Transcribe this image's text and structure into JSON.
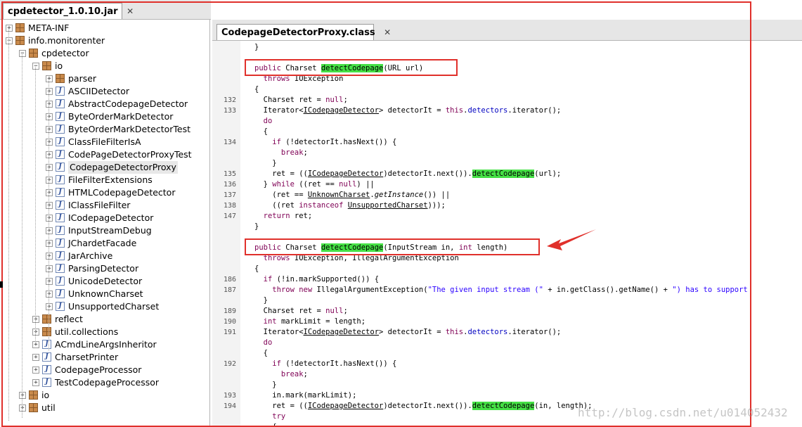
{
  "left_tab": {
    "label": "cpdetector_1.0.10.jar",
    "close": "✕"
  },
  "right_tab": {
    "label": "CodepageDetectorProxy.class",
    "close": "✕"
  },
  "tree": [
    {
      "label": "META-INF",
      "icon": "package-icon",
      "toggle": "+"
    },
    {
      "label": "info.monitorenter",
      "icon": "package-icon",
      "toggle": "−"
    },
    {
      "label": "cpdetector",
      "icon": "package-icon",
      "toggle": "−"
    },
    {
      "label": "io",
      "icon": "package-icon",
      "toggle": "−"
    },
    {
      "label": "parser",
      "icon": "package-icon",
      "toggle": "+"
    },
    {
      "label": "ASCIIDetector",
      "icon": "class-icon",
      "toggle": "+"
    },
    {
      "label": "AbstractCodepageDetector",
      "icon": "class-icon",
      "toggle": "+"
    },
    {
      "label": "ByteOrderMarkDetector",
      "icon": "class-icon",
      "toggle": "+"
    },
    {
      "label": "ByteOrderMarkDetectorTest",
      "icon": "class-icon",
      "toggle": "+"
    },
    {
      "label": "ClassFileFilterIsA",
      "icon": "class-icon",
      "toggle": "+"
    },
    {
      "label": "CodePageDetectorProxyTest",
      "icon": "class-icon",
      "toggle": "+"
    },
    {
      "label": "CodepageDetectorProxy",
      "icon": "class-icon",
      "toggle": "+",
      "selected": true
    },
    {
      "label": "FileFilterExtensions",
      "icon": "class-icon",
      "toggle": "+"
    },
    {
      "label": "HTMLCodepageDetector",
      "icon": "class-icon",
      "toggle": "+"
    },
    {
      "label": "IClassFileFilter",
      "icon": "class-icon",
      "toggle": "+"
    },
    {
      "label": "ICodepageDetector",
      "icon": "class-icon",
      "toggle": "+"
    },
    {
      "label": "InputStreamDebug",
      "icon": "class-icon",
      "toggle": "+"
    },
    {
      "label": "JChardetFacade",
      "icon": "class-icon",
      "toggle": "+"
    },
    {
      "label": "JarArchive",
      "icon": "class-icon",
      "toggle": "+"
    },
    {
      "label": "ParsingDetector",
      "icon": "class-icon",
      "toggle": "+"
    },
    {
      "label": "UnicodeDetector",
      "icon": "class-icon",
      "toggle": "+"
    },
    {
      "label": "UnknownCharset",
      "icon": "class-icon",
      "toggle": "+"
    },
    {
      "label": "UnsupportedCharset",
      "icon": "class-icon",
      "toggle": "+"
    },
    {
      "label": "reflect",
      "icon": "package-icon",
      "toggle": "+"
    },
    {
      "label": "util.collections",
      "icon": "package-icon",
      "toggle": "+"
    },
    {
      "label": "ACmdLineArgsInheritor",
      "icon": "class-icon",
      "toggle": "+"
    },
    {
      "label": "CharsetPrinter",
      "icon": "class-icon",
      "toggle": "+"
    },
    {
      "label": "CodepageProcessor",
      "icon": "class-icon",
      "toggle": "+"
    },
    {
      "label": "TestCodepageProcessor",
      "icon": "class-icon",
      "toggle": "+"
    },
    {
      "label": "io",
      "icon": "package-icon",
      "toggle": "+"
    },
    {
      "label": "util",
      "icon": "package-icon",
      "toggle": "+"
    }
  ],
  "code_lines": [
    {
      "n": "",
      "t": [
        [
          "}",
          ""
        ]
      ]
    },
    {
      "n": "",
      "t": [
        [
          "",
          ""
        ]
      ]
    },
    {
      "n": "",
      "t": [
        [
          "public ",
          "kw"
        ],
        [
          "Charset ",
          ""
        ],
        [
          "detectCodepage",
          "hl"
        ],
        [
          "(URL url)",
          ""
        ]
      ]
    },
    {
      "n": "",
      "t": [
        [
          "  throws ",
          "kw"
        ],
        [
          "IOException",
          ""
        ]
      ]
    },
    {
      "n": "",
      "t": [
        [
          "{",
          ""
        ]
      ]
    },
    {
      "n": "132",
      "t": [
        [
          "  Charset ret = ",
          ""
        ],
        [
          "null",
          "kw"
        ],
        [
          ";",
          ""
        ]
      ]
    },
    {
      "n": "133",
      "t": [
        [
          "  Iterator<",
          ""
        ],
        [
          "ICodepageDetector",
          "ul"
        ],
        [
          "> detectorIt = ",
          ""
        ],
        [
          "this",
          "kw"
        ],
        [
          ".",
          ""
        ],
        [
          "detectors",
          "fld"
        ],
        [
          ".iterator();",
          ""
        ]
      ]
    },
    {
      "n": "",
      "t": [
        [
          "  do",
          "kw"
        ]
      ]
    },
    {
      "n": "",
      "t": [
        [
          "  {",
          ""
        ]
      ]
    },
    {
      "n": "134",
      "t": [
        [
          "    ",
          ""
        ],
        [
          "if",
          "kw"
        ],
        [
          " (!detectorIt.hasNext()) {",
          ""
        ]
      ]
    },
    {
      "n": "",
      "t": [
        [
          "      break",
          "kw"
        ],
        [
          ";",
          ""
        ]
      ]
    },
    {
      "n": "",
      "t": [
        [
          "    }",
          ""
        ]
      ]
    },
    {
      "n": "135",
      "t": [
        [
          "    ret = ((",
          ""
        ],
        [
          "ICodepageDetector",
          "ul"
        ],
        [
          ")detectorIt.next()).",
          ""
        ],
        [
          "detectCodepage",
          "hl"
        ],
        [
          "(url);",
          ""
        ]
      ]
    },
    {
      "n": "136",
      "t": [
        [
          "  } ",
          ""
        ],
        [
          "while",
          "kw"
        ],
        [
          " ((ret == ",
          ""
        ],
        [
          "null",
          "kw"
        ],
        [
          ") ||",
          ""
        ]
      ]
    },
    {
      "n": "137",
      "t": [
        [
          "    (ret == ",
          ""
        ],
        [
          "UnknownCharset",
          "ul"
        ],
        [
          ".",
          ""
        ],
        [
          "getInstance",
          "it"
        ],
        [
          "()) ||",
          ""
        ]
      ]
    },
    {
      "n": "138",
      "t": [
        [
          "    ((ret ",
          ""
        ],
        [
          "instanceof",
          "kw"
        ],
        [
          " ",
          ""
        ],
        [
          "UnsupportedCharset",
          "ul"
        ],
        [
          ")));",
          ""
        ]
      ]
    },
    {
      "n": "147",
      "t": [
        [
          "  ",
          ""
        ],
        [
          "return",
          "kw"
        ],
        [
          " ret;",
          ""
        ]
      ]
    },
    {
      "n": "",
      "t": [
        [
          "}",
          ""
        ]
      ]
    },
    {
      "n": "",
      "t": [
        [
          "",
          ""
        ]
      ]
    },
    {
      "n": "",
      "t": [
        [
          "public ",
          "kw"
        ],
        [
          "Charset ",
          ""
        ],
        [
          "detectCodepage",
          "hl"
        ],
        [
          "(InputStream in, ",
          ""
        ],
        [
          "int",
          "kw"
        ],
        [
          " length)",
          ""
        ]
      ]
    },
    {
      "n": "",
      "t": [
        [
          "  throws ",
          "kw"
        ],
        [
          "IOException, IllegalArgumentException",
          ""
        ]
      ]
    },
    {
      "n": "",
      "t": [
        [
          "{",
          ""
        ]
      ]
    },
    {
      "n": "186",
      "t": [
        [
          "  ",
          ""
        ],
        [
          "if",
          "kw"
        ],
        [
          " (!in.markSupported()) {",
          ""
        ]
      ]
    },
    {
      "n": "187",
      "t": [
        [
          "    ",
          ""
        ],
        [
          "throw new",
          "kw"
        ],
        [
          " IllegalArgumentException(",
          ""
        ],
        [
          "\"The given input stream (\"",
          "str"
        ],
        [
          " + in.getClass().getName() + ",
          ""
        ],
        [
          "\") has to support",
          "str"
        ]
      ]
    },
    {
      "n": "",
      "t": [
        [
          "  }",
          ""
        ]
      ]
    },
    {
      "n": "189",
      "t": [
        [
          "  Charset ret = ",
          ""
        ],
        [
          "null",
          "kw"
        ],
        [
          ";",
          ""
        ]
      ]
    },
    {
      "n": "190",
      "t": [
        [
          "  ",
          ""
        ],
        [
          "int",
          "kw"
        ],
        [
          " markLimit = length;",
          ""
        ]
      ]
    },
    {
      "n": "191",
      "t": [
        [
          "  Iterator<",
          ""
        ],
        [
          "ICodepageDetector",
          "ul"
        ],
        [
          "> detectorIt = ",
          ""
        ],
        [
          "this",
          "kw"
        ],
        [
          ".",
          ""
        ],
        [
          "detectors",
          "fld"
        ],
        [
          ".iterator();",
          ""
        ]
      ]
    },
    {
      "n": "",
      "t": [
        [
          "  do",
          "kw"
        ]
      ]
    },
    {
      "n": "",
      "t": [
        [
          "  {",
          ""
        ]
      ]
    },
    {
      "n": "192",
      "t": [
        [
          "    ",
          ""
        ],
        [
          "if",
          "kw"
        ],
        [
          " (!detectorIt.hasNext()) {",
          ""
        ]
      ]
    },
    {
      "n": "",
      "t": [
        [
          "      break",
          "kw"
        ],
        [
          ";",
          ""
        ]
      ]
    },
    {
      "n": "",
      "t": [
        [
          "    }",
          ""
        ]
      ]
    },
    {
      "n": "193",
      "t": [
        [
          "    in.mark(markLimit);",
          ""
        ]
      ]
    },
    {
      "n": "194",
      "t": [
        [
          "    ret = ((",
          ""
        ],
        [
          "ICodepageDetector",
          "ul"
        ],
        [
          ")detectorIt.next()).",
          ""
        ],
        [
          "detectCodepage",
          "hl"
        ],
        [
          "(in, length);",
          ""
        ]
      ]
    },
    {
      "n": "",
      "t": [
        [
          "    try",
          "kw"
        ]
      ]
    },
    {
      "n": "",
      "t": [
        [
          "    {",
          ""
        ]
      ]
    }
  ],
  "watermark": "http://blog.csdn.net/u014052432",
  "colors": {
    "annotation_red": "#e0302b",
    "highlight_green": "#45e045"
  }
}
